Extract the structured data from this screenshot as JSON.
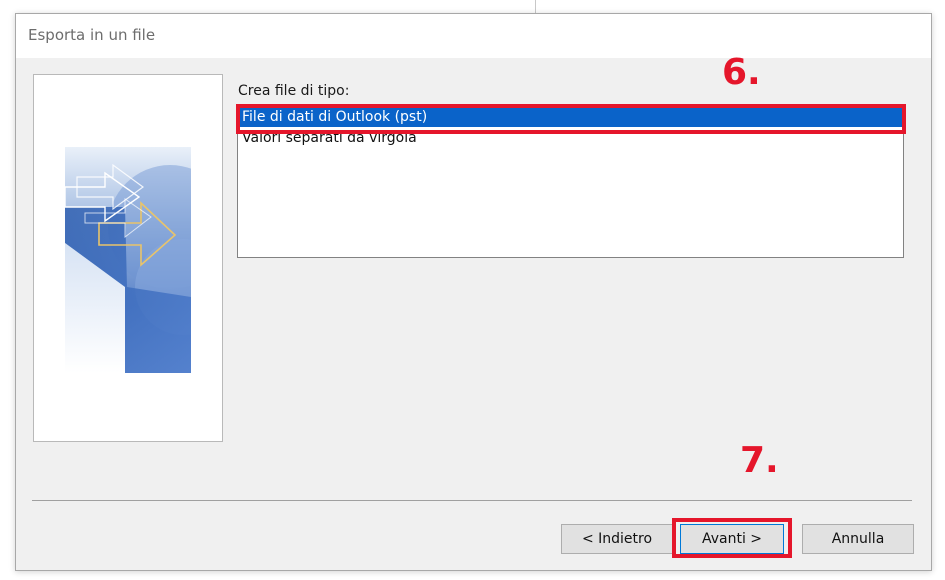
{
  "dialog": {
    "title": "Esporta in un file"
  },
  "list": {
    "label": "Crea file di tipo:",
    "items": [
      {
        "label": "File di dati di Outlook (pst)",
        "selected": true
      },
      {
        "label": "Valori separati da virgola",
        "selected": false
      }
    ]
  },
  "annotations": {
    "step6": "6.",
    "step7": "7.",
    "color": "#e5162b"
  },
  "buttons": {
    "back_label": "< Indietro",
    "next_label": "Avanti >",
    "cancel_label": "Annulla"
  },
  "colors": {
    "selection": "#0a63c9",
    "dialog_bg": "#f0f0f0"
  }
}
